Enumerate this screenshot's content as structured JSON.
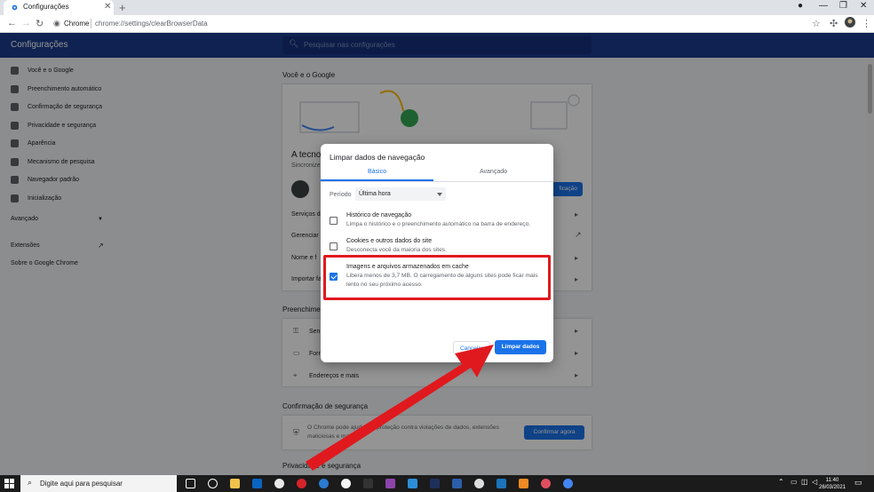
{
  "browser": {
    "tab_title": "Configurações",
    "origin": "Chrome",
    "url": "chrome://settings/clearBrowserData"
  },
  "header": {
    "title": "Configurações",
    "search_placeholder": "Pesquisar nas configurações"
  },
  "sidebar": {
    "items": [
      {
        "label": "Você e o Google",
        "icon": "person-icon"
      },
      {
        "label": "Preenchimento automático",
        "icon": "clipboard-icon"
      },
      {
        "label": "Confirmação de segurança",
        "icon": "shield-icon"
      },
      {
        "label": "Privacidade e segurança",
        "icon": "shield-lock-icon"
      },
      {
        "label": "Aparência",
        "icon": "palette-icon"
      },
      {
        "label": "Mecanismo de pesquisa",
        "icon": "search-icon"
      },
      {
        "label": "Navegador padrão",
        "icon": "browser-icon"
      },
      {
        "label": "Inicialização",
        "icon": "power-icon"
      }
    ],
    "advanced": "Avançado",
    "extensions": "Extensões",
    "about": "Sobre o Google Chrome"
  },
  "main": {
    "section_you": "Você e o Google",
    "sync_title": "A tecnol",
    "sync_sub": "Sincronize",
    "sync_button": "ficação",
    "rows": [
      "Serviços do",
      "Gerenciar",
      "Nome e f",
      "Importar fa"
    ],
    "section_autofill": "Preenchime",
    "autofill_rows": [
      "Senh",
      "Form",
      "Endereços e mais"
    ],
    "section_safety": "Confirmação de segurança",
    "safety_text_1": "O Chrome pode ajudar na proteção contra violações de dados, extensões",
    "safety_text_2": "maliciosas e mais",
    "safety_button": "Confirmar agora",
    "section_privacy": "Privacidade e segurança"
  },
  "dialog": {
    "title": "Limpar dados de navegação",
    "tabs": [
      "Básico",
      "Avançado"
    ],
    "active_tab": "Básico",
    "period_label": "Período",
    "period_value": "Última hora",
    "options": [
      {
        "title": "Histórico de navegação",
        "desc": "Limpa o histórico e o preenchimento automático na barra de endereço.",
        "checked": false
      },
      {
        "title": "Cookies e outros dados do site",
        "desc": "Desconecta você da maioria dos sites.",
        "checked": false
      },
      {
        "title": "Imagens e arquivos armazenados em cache",
        "desc": "Libera menos de 3,7 MB. O carregamento de alguns sites pode ficar mais lento no seu próximo acesso.",
        "checked": true
      }
    ],
    "cancel_label": "Cancelar",
    "clear_label": "Limpar dados"
  },
  "taskbar": {
    "search_placeholder": "Digite aqui para pesquisar",
    "time": "11:40",
    "date": "26/03/2021"
  },
  "colors": {
    "header": "#1a3b8c",
    "accent": "#1a73e8",
    "highlight": "#e0191e"
  }
}
